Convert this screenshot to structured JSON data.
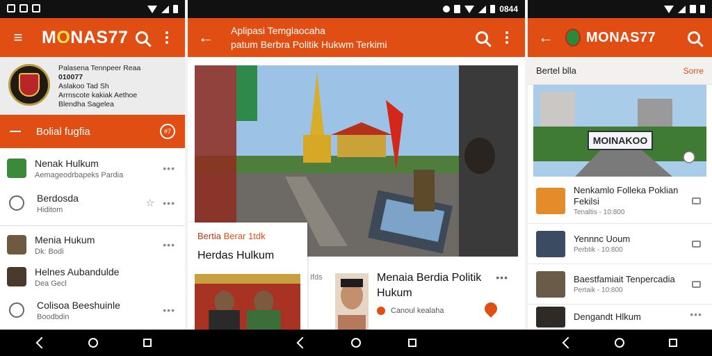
{
  "phone1": {
    "status": {
      "time": ""
    },
    "brand": {
      "prefix": "M",
      "o": "O",
      "rest": "NAS77"
    },
    "profile": {
      "line1": "Palasena Tennpeer Reaa",
      "line2": "010077",
      "line3": "Aslakoo Tad Sh",
      "line4": "Arrnscote kakiak Aethoe",
      "line5": "Blendha Sagelea"
    },
    "banner": {
      "label": "Bolial fugfia",
      "badge": "#7"
    },
    "items": [
      {
        "title": "Nenak Hulkum",
        "subtitle": "Aemageodrbapeks Pardia"
      },
      {
        "title": "Berdosda",
        "subtitle": "Hiditom"
      },
      {
        "title": "Menia Hukum",
        "subtitle": "Dk: Bodi"
      },
      {
        "title": "Helnes Aubandulde",
        "subtitle": "Dea Gecl"
      },
      {
        "title": "Colisoa Beeshuinle",
        "subtitle": "Boodbdin"
      }
    ]
  },
  "phone2": {
    "status": {
      "time": "0844"
    },
    "title": {
      "line1": "Aplipasi Temglaocaha",
      "line2": "patum Berbra Politik Hukwm Terkimi"
    },
    "card": {
      "label_a": "Bertia",
      "label_b": "Berar 1tdk",
      "title": "Herdas Hulkum"
    },
    "article": {
      "kicker": "Ifds",
      "title": "Menaia Berdia Politik Hukum",
      "source": "Canoul kealaha"
    }
  },
  "phone3": {
    "brand": "MONAS77",
    "section": {
      "left": "Bertel blla",
      "right": "Sorre"
    },
    "city_sign": "MOINAKOO",
    "items": [
      {
        "title": "Nenkamlo Folleka Poklian Fekilsi",
        "subtitle": "Tenaltis - 10:800"
      },
      {
        "title": "Yennnc Uoum",
        "subtitle": "Perbtik - 10:800"
      },
      {
        "title": "Baestfamiait Tenpercadia",
        "subtitle": "Pertaik - 10:800"
      },
      {
        "title": "Dengandt Hlkum",
        "subtitle": ""
      }
    ]
  },
  "colors": {
    "accent": "#e04e14",
    "brand_o": "#f6e24a"
  }
}
